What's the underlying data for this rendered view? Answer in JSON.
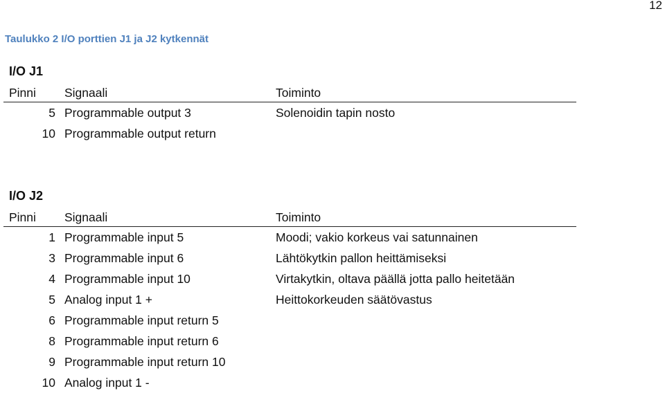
{
  "page_number": "12",
  "caption": "Taulukko 2 I/O porttien J1 ja J2 kytkennät",
  "columns": {
    "pin": "Pinni",
    "signal": "Signaali",
    "function": "Toiminto"
  },
  "j1": {
    "title": "I/O J1",
    "rows": [
      {
        "pin": "5",
        "signal": "Programmable output 3",
        "function": "Solenoidin tapin nosto"
      },
      {
        "pin": "10",
        "signal": "Programmable output return",
        "function": ""
      }
    ]
  },
  "j2": {
    "title": "I/O J2",
    "rows": [
      {
        "pin": "1",
        "signal": "Programmable input 5",
        "function": "Moodi; vakio korkeus vai satunnainen"
      },
      {
        "pin": "3",
        "signal": "Programmable input 6",
        "function": "Lähtökytkin pallon heittämiseksi"
      },
      {
        "pin": "4",
        "signal": "Programmable input 10",
        "function": "Virtakytkin, oltava päällä jotta pallo heitetään"
      },
      {
        "pin": "5",
        "signal": "Analog input 1 +",
        "function": "Heittokorkeuden säätövastus"
      },
      {
        "pin": "6",
        "signal": "Programmable input return 5",
        "function": ""
      },
      {
        "pin": "8",
        "signal": "Programmable input return 6",
        "function": ""
      },
      {
        "pin": "9",
        "signal": "Programmable input return 10",
        "function": ""
      },
      {
        "pin": "10",
        "signal": "Analog input 1 -",
        "function": ""
      }
    ]
  }
}
